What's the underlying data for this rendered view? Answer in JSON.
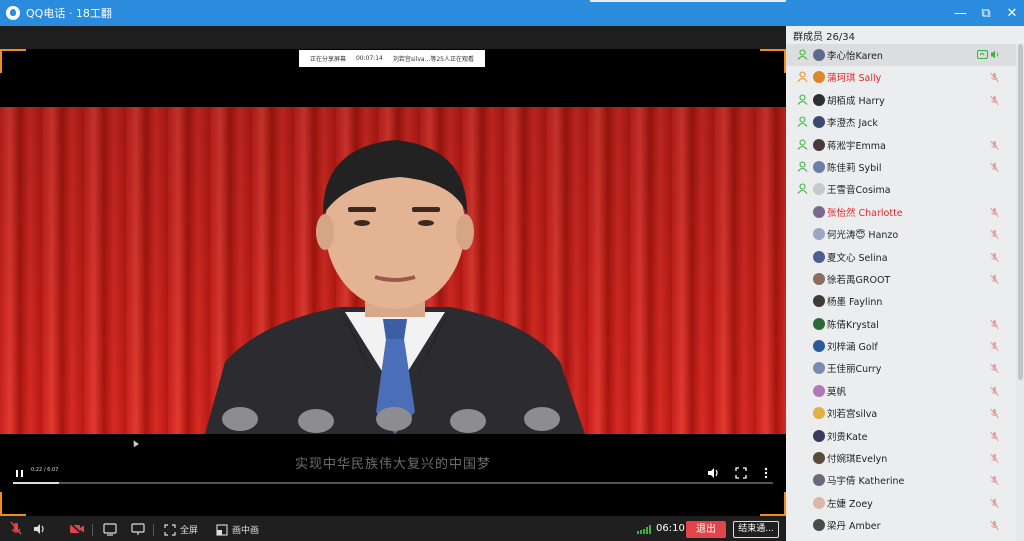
{
  "window": {
    "app": "QQ电话",
    "separator": " · ",
    "group": "18工翻",
    "minimize": "—",
    "restore": "⧉",
    "close": "✕"
  },
  "share_bar": {
    "status": "正在分享屏幕",
    "elapsed": "00:07:14",
    "viewers": "刘若宫silva...等25人正在观看"
  },
  "video": {
    "caption": "实现中华民族伟大复兴的中国梦",
    "time": "0:22 / 6:07",
    "progress": 0.06
  },
  "toolbar": {
    "fullscreen": "全屏",
    "pip": "画中画",
    "call_time": "06:10",
    "exit": "退出",
    "end": "结束通..."
  },
  "panel": {
    "header": "群成员 26/34",
    "members": [
      {
        "name": "李心怡Karen",
        "admin": true,
        "red": false,
        "muted": false,
        "speaking": true,
        "avatar": "#5a6b8c"
      },
      {
        "name": "蒲珂琪 Sally",
        "admin": true,
        "red": true,
        "muted": true,
        "speaking": false,
        "avatar": "#d9892b"
      },
      {
        "name": "胡栢成 Harry",
        "admin": true,
        "red": false,
        "muted": true,
        "speaking": false,
        "avatar": "#2f2f2f"
      },
      {
        "name": "李澄杰 Jack",
        "admin": true,
        "red": false,
        "muted": false,
        "speaking": false,
        "avatar": "#3a4a6e"
      },
      {
        "name": "蒋淞宇Emma",
        "admin": true,
        "red": false,
        "muted": true,
        "speaking": false,
        "avatar": "#4a3a3a"
      },
      {
        "name": "陈佳莉 Sybil",
        "admin": true,
        "red": false,
        "muted": true,
        "speaking": false,
        "avatar": "#6b7fa8"
      },
      {
        "name": "王雪音Cosima",
        "admin": true,
        "red": false,
        "muted": false,
        "speaking": false,
        "avatar": "#c9c9c9"
      },
      {
        "name": "张怡然 Charlotte",
        "admin": false,
        "red": true,
        "muted": true,
        "speaking": false,
        "avatar": "#7b6a8e"
      },
      {
        "name": "何光涛😇 Hanzo",
        "admin": false,
        "red": false,
        "muted": true,
        "speaking": false,
        "avatar": "#9aa8c4"
      },
      {
        "name": "夏文心 Selina",
        "admin": false,
        "red": false,
        "muted": true,
        "speaking": false,
        "avatar": "#4c5f8e"
      },
      {
        "name": "徐若禹GROOT",
        "admin": false,
        "red": false,
        "muted": true,
        "speaking": false,
        "avatar": "#8a6d5a"
      },
      {
        "name": "杨墨 Faylinn",
        "admin": false,
        "red": false,
        "muted": false,
        "speaking": false,
        "avatar": "#3f3a35"
      },
      {
        "name": "陈倩Krystal",
        "admin": false,
        "red": false,
        "muted": true,
        "speaking": false,
        "avatar": "#2d6a3a"
      },
      {
        "name": "刘梓涵 Golf",
        "admin": false,
        "red": false,
        "muted": true,
        "speaking": false,
        "avatar": "#2a5a9a"
      },
      {
        "name": "王佳丽Curry",
        "admin": false,
        "red": false,
        "muted": true,
        "speaking": false,
        "avatar": "#7a8ab0"
      },
      {
        "name": "莫帆",
        "admin": false,
        "red": false,
        "muted": true,
        "speaking": false,
        "avatar": "#b07ab8"
      },
      {
        "name": "刘若宫silva",
        "admin": false,
        "red": false,
        "muted": true,
        "speaking": false,
        "avatar": "#e0b040"
      },
      {
        "name": "刘贵Kate",
        "admin": false,
        "red": false,
        "muted": true,
        "speaking": false,
        "avatar": "#3a3a5a"
      },
      {
        "name": "付婉琪Evelyn",
        "admin": false,
        "red": false,
        "muted": true,
        "speaking": false,
        "avatar": "#5a4a3a"
      },
      {
        "name": "马宇倩 Katherine",
        "admin": false,
        "red": false,
        "muted": true,
        "speaking": false,
        "avatar": "#6a6a7a"
      },
      {
        "name": "左婕 Zoey",
        "admin": false,
        "red": false,
        "muted": true,
        "speaking": false,
        "avatar": "#d8b8a8"
      },
      {
        "name": "梁丹 Amber",
        "admin": false,
        "red": false,
        "muted": true,
        "speaking": false,
        "avatar": "#4a4a4a"
      }
    ]
  },
  "colors": {
    "titlebar": "#2b8bdd",
    "accent_orange": "#f08a24",
    "exit_red": "#e1454a",
    "muted_red": "#e1292f",
    "speaking_green": "#3cb43c"
  }
}
